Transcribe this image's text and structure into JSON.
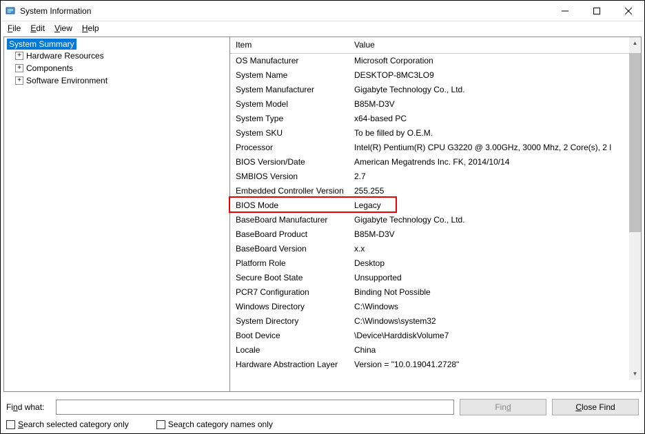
{
  "window": {
    "title": "System Information"
  },
  "menu": {
    "file": "File",
    "edit": "Edit",
    "view": "View",
    "help": "Help"
  },
  "tree": {
    "root": "System Summary",
    "children": [
      {
        "label": "Hardware Resources"
      },
      {
        "label": "Components"
      },
      {
        "label": "Software Environment"
      }
    ]
  },
  "table": {
    "headers": {
      "item": "Item",
      "value": "Value"
    },
    "rows": [
      {
        "item": "OS Manufacturer",
        "value": "Microsoft Corporation"
      },
      {
        "item": "System Name",
        "value": "DESKTOP-8MC3LO9"
      },
      {
        "item": "System Manufacturer",
        "value": "Gigabyte Technology Co., Ltd."
      },
      {
        "item": "System Model",
        "value": "B85M-D3V"
      },
      {
        "item": "System Type",
        "value": "x64-based PC"
      },
      {
        "item": "System SKU",
        "value": "To be filled by O.E.M."
      },
      {
        "item": "Processor",
        "value": "Intel(R) Pentium(R) CPU G3220 @ 3.00GHz, 3000 Mhz, 2 Core(s), 2 l"
      },
      {
        "item": "BIOS Version/Date",
        "value": "American Megatrends Inc. FK, 2014/10/14"
      },
      {
        "item": "SMBIOS Version",
        "value": "2.7"
      },
      {
        "item": "Embedded Controller Version",
        "value": "255.255"
      },
      {
        "item": "BIOS Mode",
        "value": "Legacy"
      },
      {
        "item": "BaseBoard Manufacturer",
        "value": "Gigabyte Technology Co., Ltd."
      },
      {
        "item": "BaseBoard Product",
        "value": "B85M-D3V"
      },
      {
        "item": "BaseBoard Version",
        "value": "x.x"
      },
      {
        "item": "Platform Role",
        "value": "Desktop"
      },
      {
        "item": "Secure Boot State",
        "value": "Unsupported"
      },
      {
        "item": "PCR7 Configuration",
        "value": "Binding Not Possible"
      },
      {
        "item": "Windows Directory",
        "value": "C:\\Windows"
      },
      {
        "item": "System Directory",
        "value": "C:\\Windows\\system32"
      },
      {
        "item": "Boot Device",
        "value": "\\Device\\HarddiskVolume7"
      },
      {
        "item": "Locale",
        "value": "China"
      },
      {
        "item": "Hardware Abstraction Layer",
        "value": "Version = \"10.0.19041.2728\""
      }
    ],
    "highlight_index": 10
  },
  "find": {
    "label": "Find what:",
    "input_value": "",
    "find_button": "Find",
    "close_button": "Close Find",
    "check1": "Search selected category only",
    "check2": "Search category names only"
  }
}
